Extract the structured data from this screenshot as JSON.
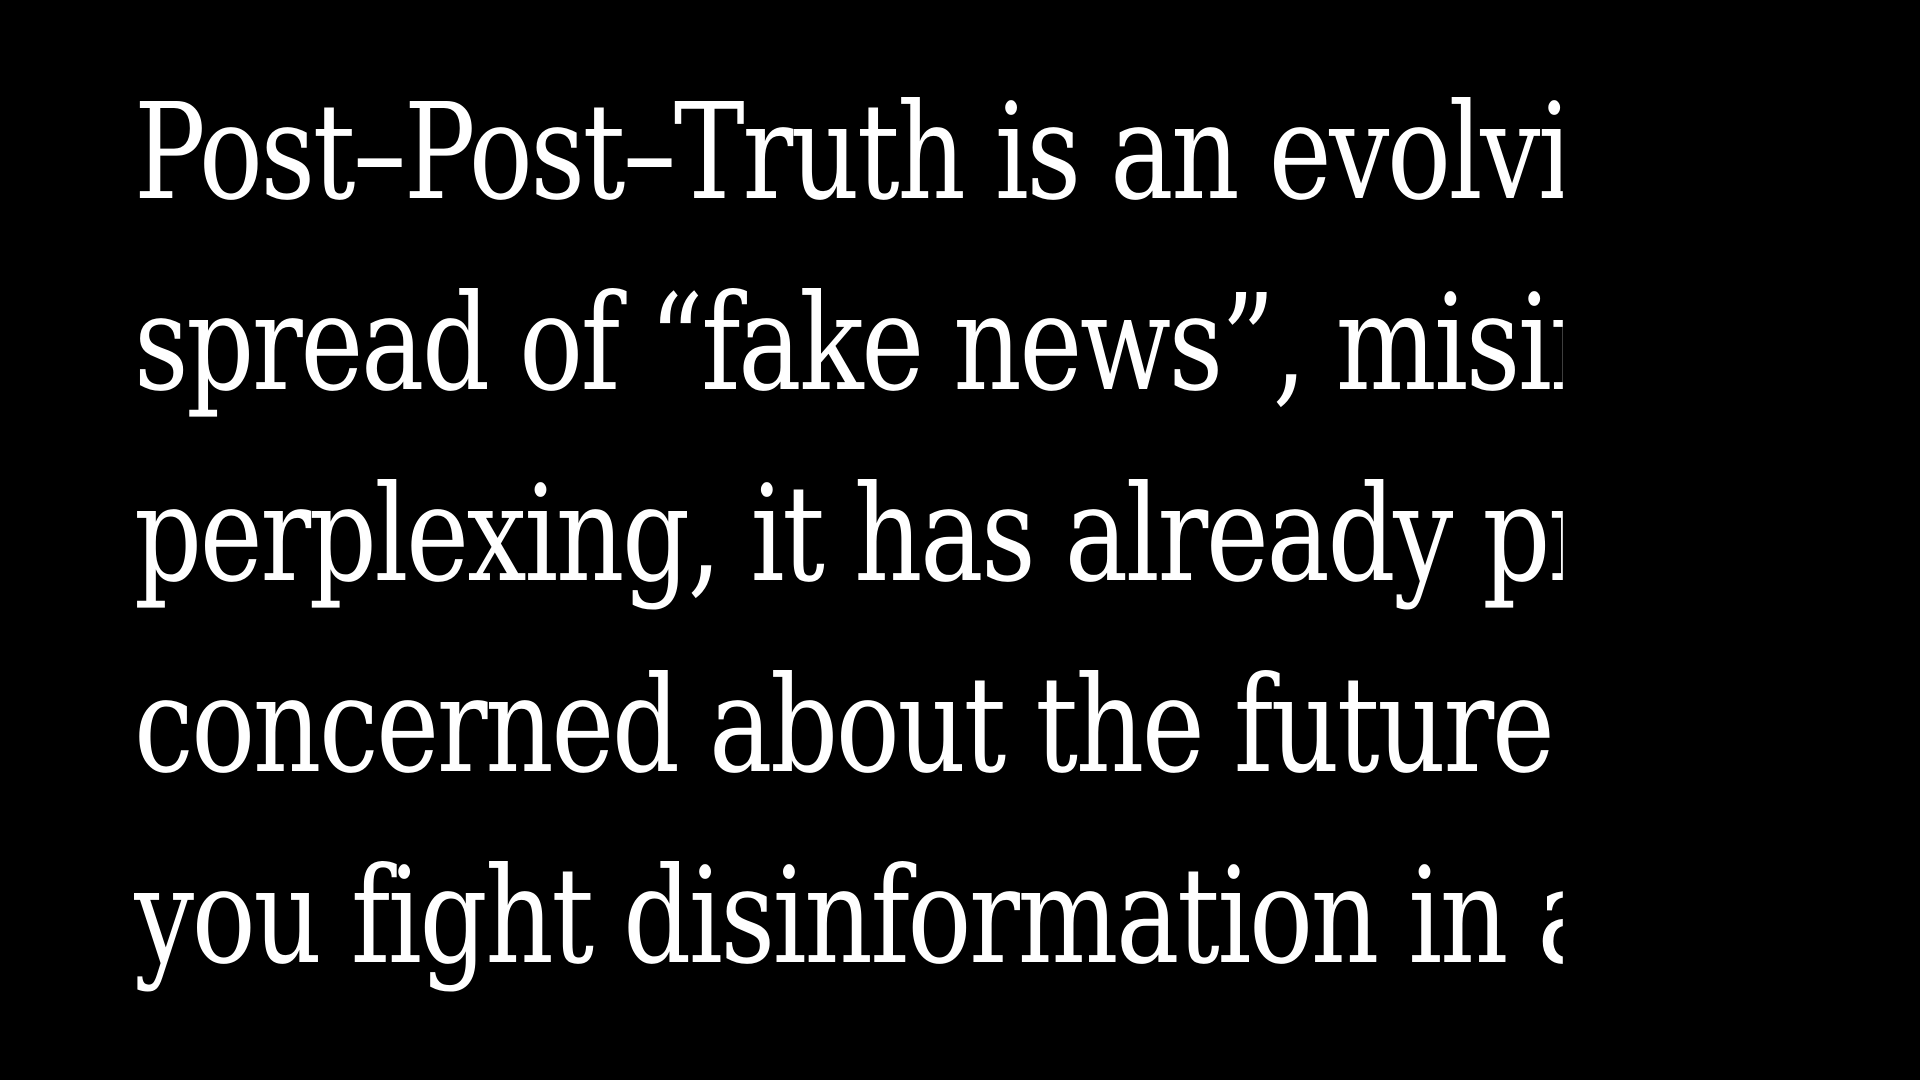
{
  "background_color": "#000000",
  "text_color": "#ffffff",
  "lines": [
    "Post–Post–Truth is an evolving",
    "spread of “fake news”, misinfor",
    "perplexing, it has already prove",
    "concerned about the future of",
    "you fight disinformation in an"
  ]
}
